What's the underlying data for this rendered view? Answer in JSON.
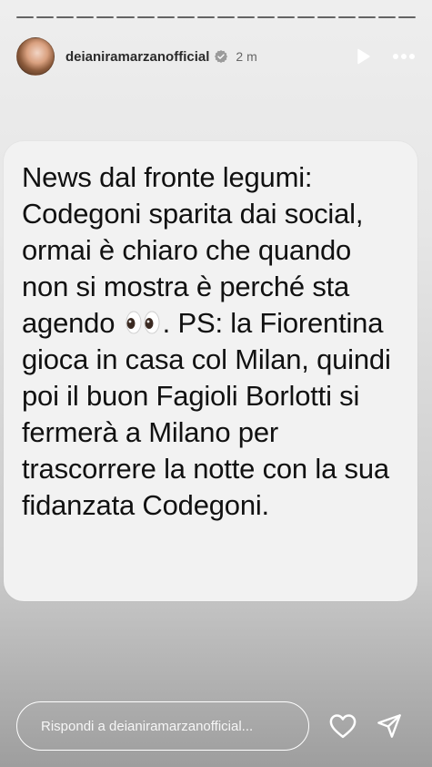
{
  "story": {
    "segments": 20,
    "username": "deianiramarzanofficial",
    "time": "2 m",
    "verified": true,
    "icons": {
      "avatar": "profile-avatar",
      "verified": "verified-badge-icon",
      "play": "play-icon",
      "more": "more-dots-icon"
    }
  },
  "post": {
    "text_before_emoji": "News dal fronte legumi: Codegoni sparita dai social, ormai è chiaro che quando non si mostra è perché sta agendo",
    "emoji": "eyes-emoji",
    "text_after_emoji": ". PS: la Fiorentina gioca in casa col Milan, quindi poi il buon Fagioli Borlotti si fermerà a Milano per trascorrere la notte con la sua fidanzata Codegoni."
  },
  "reply": {
    "placeholder": "Rispondi a deianiramarzanofficial...",
    "icons": {
      "like": "heart-icon",
      "send": "send-icon"
    }
  },
  "colors": {
    "card": "#f2f2f2",
    "text": "#111111"
  }
}
